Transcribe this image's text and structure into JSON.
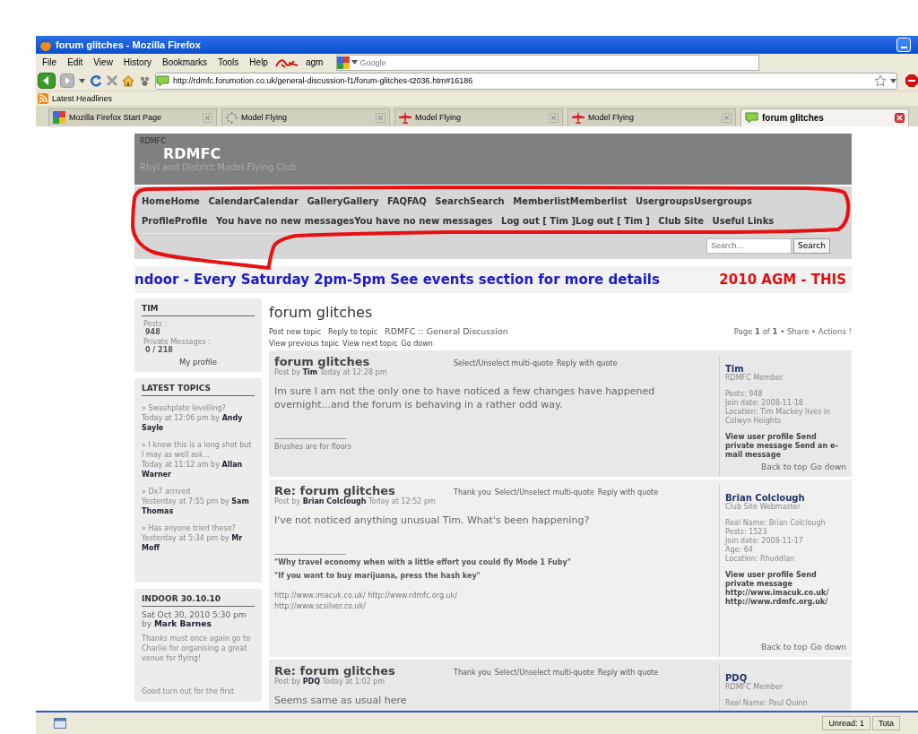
{
  "window": {
    "title": "forum glitches - Mozilla Firefox"
  },
  "menu": [
    "File",
    "Edit",
    "View",
    "History",
    "Bookmarks",
    "Tools",
    "Help"
  ],
  "toolbar_user": "agm",
  "search_engine": {
    "placeholder": "Google"
  },
  "address": {
    "value": "http://rdmfc.forumotion.co.uk/general-discussion-f1/forum-glitches-t2036.htm#16186"
  },
  "bookmarks": [
    "Latest Headlines"
  ],
  "tabs": [
    {
      "label": "Mozilla Firefox Start Page",
      "kind": "google",
      "selected": false
    },
    {
      "label": "Model Flying",
      "kind": "loading",
      "selected": false
    },
    {
      "label": "Model Flying",
      "kind": "plane",
      "selected": false
    },
    {
      "label": "Model Flying",
      "kind": "plane",
      "selected": false
    },
    {
      "label": "forum glitches",
      "kind": "bubble",
      "selected": true
    }
  ],
  "site": {
    "small_title": "RDMFC",
    "title": "RDMFC",
    "subtitle": "Rhyl and District Model Flying Club"
  },
  "nav_links": [
    "HomeHome",
    "CalendarCalendar",
    "GalleryGallery",
    "FAQFAQ",
    "SearchSearch",
    "MemberlistMemberlist",
    "UsergroupsUsergroups",
    "ProfileProfile",
    "You have no new messagesYou have no new messages",
    "Log out [ Tim ]Log out [ Tim ]",
    "Club Site",
    "Useful Links"
  ],
  "search": {
    "placeholder": "Search...",
    "button": "Search"
  },
  "marquee": [
    {
      "text": "ndoor - Every Saturday 2pm-5pm See events section for more details",
      "color": "#1a1ad0"
    },
    {
      "text": "2010 AGM - THIS",
      "color": "#e01010"
    }
  ],
  "profile_widget": {
    "title": "TIM",
    "posts_label": "Posts :",
    "posts": "948",
    "pm_label": "Private Messages :",
    "pm": "0 / 218",
    "link": "My profile"
  },
  "latest_topics": {
    "title": "LATEST TOPICS",
    "items": [
      {
        "topic": "» Swashplate levelling?",
        "meta": "Today at 12:06 pm by **Andy Sayle**"
      },
      {
        "topic": "» I know this is a long shot but I may as well ask...",
        "meta": "Today at 11:12 am by **Allan Warner**"
      },
      {
        "topic": "» Dx7 arrived",
        "meta": "Yesterday at 7:55 pm by **Sam Thomas**"
      },
      {
        "topic": "» Has anyone tried these?",
        "meta": "Yesterday at 5:34 pm by **Mr Moff**"
      }
    ]
  },
  "news": {
    "title": "INDOOR 30.10.10",
    "date": "Sat Oct 30, 2010 5:30 pm",
    "by": "by **Mark Barnes**",
    "paragraphs": [
      "Thanks must once again go to Charlie for organising a great venue for flying!",
      "Good turn out for the first"
    ]
  },
  "topic": {
    "title": "forum glitches",
    "actions": [
      "Post new topic",
      "Reply to topic"
    ],
    "breadcrumb": "RDMFC :: General Discussion",
    "pagination": "Page **1** of **1** • Share • Actions !",
    "nav": [
      "View previous topic",
      "View next topic",
      "Go down"
    ]
  },
  "posts": [
    {
      "title": "forum glitches",
      "byline": "Post by **Tim** Today at 12:28 pm",
      "actions": [
        "Select/Unselect multi-quote",
        "Reply with quote"
      ],
      "body": "Im sure I am not the only one to have noticed a few changes have happened overnight...and the forum is behaving in a rather odd way.",
      "signature": [
        {
          "kind": "plain",
          "text": "Brushes are for floors"
        }
      ],
      "author": {
        "name": "Tim",
        "rank": "RDMFC Member",
        "details": [
          "Posts: 948",
          "Join date: 2008-11-18",
          "Location: Tim Mackey lives in Colwyn Heights"
        ],
        "links": "View user profile Send private message Send an e-mail message",
        "footer": [
          "Back to top",
          "Go down"
        ]
      }
    },
    {
      "title": "Re: forum glitches",
      "byline": "Post by **Brian Colclough** Today at 12:52 pm",
      "actions": [
        "Thank you",
        "Select/Unselect multi-quote",
        "Reply with quote"
      ],
      "body": "I've not noticed anything unusual Tim. What's been happening?",
      "signature": [
        {
          "kind": "quote",
          "text": "\"Why travel economy when with a little effort you could fly Mode 1 Fuby\""
        },
        {
          "kind": "quote",
          "text": "\"If you want to buy marijuana, press the hash key\""
        },
        {
          "kind": "plain",
          "text": "http://www.imacuk.co.uk/ http://www.rdmfc.org.uk/"
        },
        {
          "kind": "plain",
          "text": "http://www.scsilver.co.uk/"
        }
      ],
      "author": {
        "name": "Brian Colclough",
        "rank": "Club Site Webmaster",
        "details": [
          "Real Name: Brian Colclough",
          "Posts: 1523",
          "Join date: 2008-11-17",
          "Age: 64",
          "Location: Rhuddlan"
        ],
        "links": "View user profile Send private message http://www.imacuk.co.uk/ http://www.rdmfc.org.uk/",
        "footer": [
          "Back to top",
          "Go down"
        ]
      }
    },
    {
      "title": "Re: forum glitches",
      "byline": "Post by **PDQ** Today at 1:02 pm",
      "actions": [
        "Thank you",
        "Select/Unselect multi-quote",
        "Reply with quote"
      ],
      "body": "Seems same as usual here",
      "author": {
        "name": "PDQ",
        "rank": "RDMFC Member",
        "details": [
          "Real Name: Paul Quinn"
        ]
      }
    }
  ],
  "status_bar": [
    "Unread: 1",
    "Tota"
  ]
}
